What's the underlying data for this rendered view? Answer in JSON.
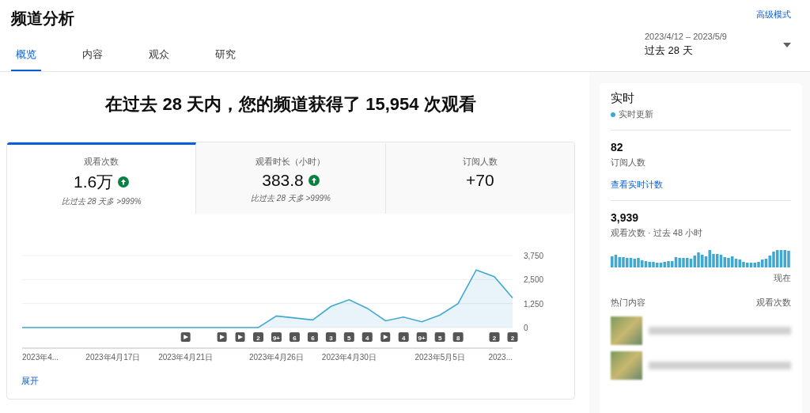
{
  "header": {
    "title": "频道分析",
    "advanced_link": "高级模式"
  },
  "tabs": [
    {
      "label": "概览",
      "selected": true
    },
    {
      "label": "内容",
      "selected": false
    },
    {
      "label": "观众",
      "selected": false
    },
    {
      "label": "研究",
      "selected": false
    }
  ],
  "date_range": {
    "range": "2023/4/12 – 2023/5/9",
    "label": "过去 28 天"
  },
  "headline": "在过去 28 天内，您的频道获得了 15,954 次观看",
  "metrics": [
    {
      "label": "观看次数",
      "value": "1.6万",
      "rising": true,
      "comparison": "比过去 28 天多 >999%",
      "selected": true
    },
    {
      "label": "观看时长（小时）",
      "value": "383.8",
      "rising": true,
      "comparison": "比过去 28 天多 >999%",
      "selected": false
    },
    {
      "label": "订阅人数",
      "value": "+70",
      "rising": false,
      "selected": false
    }
  ],
  "chart": {
    "chart_data": {
      "type": "area",
      "categories": [
        null,
        null,
        null,
        null,
        null,
        "2023年4月17日",
        null,
        null,
        null,
        "2023年4月21日",
        null,
        null,
        null,
        null,
        "2023年4月26日",
        null,
        null,
        null,
        "2023年4月30日",
        null,
        null,
        null,
        null,
        "2023年5月5日",
        null,
        null,
        null,
        null
      ],
      "series": [
        {
          "color": "#41a8d0",
          "values": [
            0,
            0,
            0,
            0,
            0,
            0,
            0,
            0,
            0,
            0,
            0,
            0,
            0,
            0,
            600,
            500,
            400,
            1100,
            1450,
            1000,
            350,
            550,
            300,
            650,
            1250,
            3000,
            2650,
            1550
          ]
        }
      ],
      "ylim": [
        0,
        3750
      ],
      "yticks": [
        {
          "value": 0,
          "label": "0"
        },
        {
          "value": 1250,
          "label": "1,250"
        },
        {
          "value": 2500,
          "label": "2,500"
        },
        {
          "value": 3750,
          "label": "3,750"
        }
      ]
    },
    "first_date_label": "2023年4...",
    "last_date_label": "2023...",
    "markers": [
      {
        "kind": "none"
      },
      {
        "kind": "none"
      },
      {
        "kind": "none"
      },
      {
        "kind": "none"
      },
      {
        "kind": "none"
      },
      {
        "kind": "none"
      },
      {
        "kind": "none"
      },
      {
        "kind": "none"
      },
      {
        "kind": "none"
      },
      {
        "kind": "video"
      },
      {
        "kind": "none"
      },
      {
        "kind": "video"
      },
      {
        "kind": "video"
      },
      {
        "kind": "count",
        "text": "2"
      },
      {
        "kind": "count",
        "text": "9+"
      },
      {
        "kind": "count",
        "text": "6"
      },
      {
        "kind": "count",
        "text": "6"
      },
      {
        "kind": "count",
        "text": "3"
      },
      {
        "kind": "count",
        "text": "5"
      },
      {
        "kind": "count",
        "text": "4"
      },
      {
        "kind": "video"
      },
      {
        "kind": "count",
        "text": "4"
      },
      {
        "kind": "count",
        "text": "9+"
      },
      {
        "kind": "count",
        "text": "5"
      },
      {
        "kind": "count",
        "text": "8"
      },
      {
        "kind": "none"
      },
      {
        "kind": "count",
        "text": "2"
      },
      {
        "kind": "count",
        "text": "2"
      }
    ],
    "expand_link": "展开"
  },
  "realtime": {
    "title": "实时",
    "status": "实时更新",
    "subscribers": "82",
    "subscribers_label": "订阅人数",
    "live_link": "查看实时计数",
    "views": "3,939",
    "views_label": "观看次数 · 过去 48 小时",
    "now_label": "现在",
    "top_content_label": "热门内容",
    "top_views_label": "观看次数"
  }
}
